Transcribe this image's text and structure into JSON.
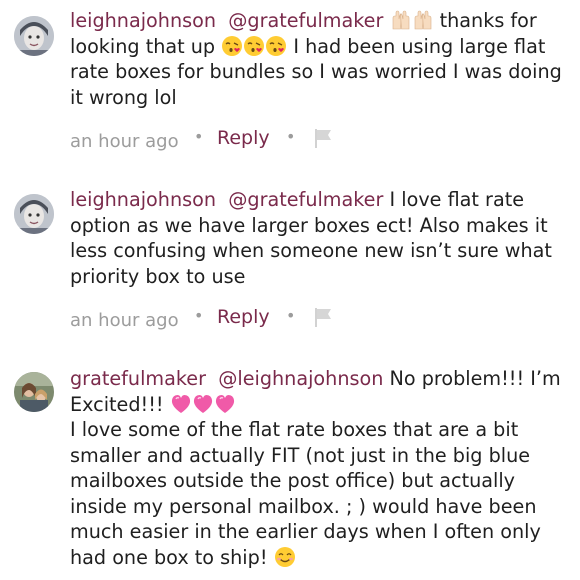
{
  "comments": [
    {
      "username": "leighnajohnson",
      "mention": "@gratefulmaker",
      "emoji_after_mention": [
        "raised-hands-emoji",
        "raised-hands-emoji"
      ],
      "text_1": "thanks for looking that up",
      "emoji_mid": [
        "kissing-heart-emoji",
        "kissing-heart-emoji",
        "kissing-heart-emoji"
      ],
      "text_2": "I had been using large flat rate boxes for bundles so I was worried I was doing it wrong lol",
      "timestamp": "an hour ago",
      "reply_label": "Reply"
    },
    {
      "username": "leighnajohnson",
      "mention": "@gratefulmaker",
      "text_1": "I love flat rate option as we have larger boxes ect! Also makes it less confusing when someone new isn’t sure what priority box to use",
      "timestamp": "an hour ago",
      "reply_label": "Reply"
    },
    {
      "username": "gratefulmaker",
      "mention": "@leighnajohnson",
      "text_1": "No problem!!! I’m Excited!!!",
      "emoji_after_text": [
        "heart-emoji",
        "heart-emoji",
        "heart-emoji"
      ],
      "text_2": "I love some of the flat rate boxes that are a bit smaller and actually FIT (not just in the big blue mailboxes outside the post office) but actually inside my personal mailbox. ; ) would have been much easier in the earlier days when I often only had one box to ship!",
      "emoji_end": "smiling-emoji"
    }
  ],
  "colors": {
    "username": "#7a2a4b",
    "text": "#1f1f1f",
    "meta": "#9c9c9c"
  },
  "separator": "•",
  "icons": {
    "flag": "flag-icon"
  }
}
